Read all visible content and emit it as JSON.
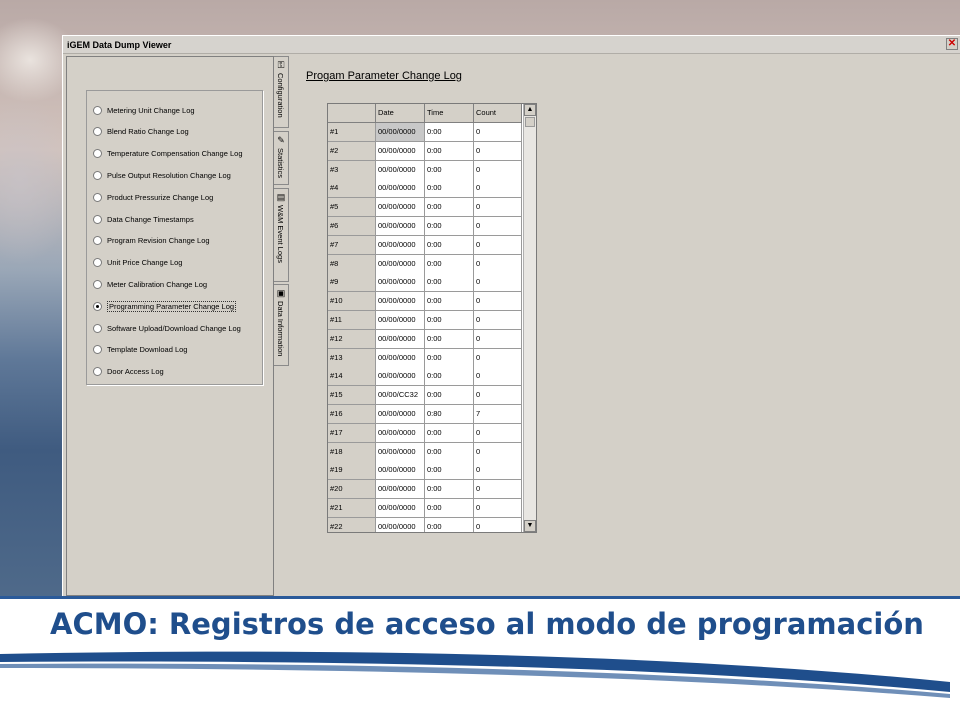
{
  "window": {
    "title": "iGEM Data Dump Viewer",
    "close_glyph": "✕"
  },
  "left_panel": {
    "options": [
      {
        "label": "Metering Unit Change Log",
        "checked": false
      },
      {
        "label": "Blend Ratio Change Log",
        "checked": false
      },
      {
        "label": "Temperature Compensation Change Log",
        "checked": false
      },
      {
        "label": "Pulse Output Resolution Change Log",
        "checked": false
      },
      {
        "label": "Product Pressurize Change Log",
        "checked": false
      },
      {
        "label": "Data Change Timestamps",
        "checked": false
      },
      {
        "label": "Program Revision Change Log",
        "checked": false
      },
      {
        "label": "Unit Price Change Log",
        "checked": false
      },
      {
        "label": "Meter Calibration Change Log",
        "checked": false
      },
      {
        "label": "Programming Parameter Change Log",
        "checked": true
      },
      {
        "label": "Software Upload/Download Change Log",
        "checked": false
      },
      {
        "label": "Template Download Log",
        "checked": false
      },
      {
        "label": "Door Access Log",
        "checked": false
      }
    ]
  },
  "tabs": [
    {
      "label": "Configuration",
      "icon": "key-icon"
    },
    {
      "label": "Statistics",
      "icon": "pencil-icon"
    },
    {
      "label": "W&M Event Logs",
      "icon": "book-icon"
    },
    {
      "label": "Data Information",
      "icon": "igem-icon"
    }
  ],
  "panel": {
    "title": "Progam Parameter Change Log"
  },
  "grid": {
    "columns": [
      "",
      "Date",
      "Time",
      "Count"
    ],
    "rows": [
      {
        "id": "#1",
        "date": "00/00/0000",
        "time": "0:00",
        "count": "0"
      },
      {
        "id": "#2",
        "date": "00/00/0000",
        "time": "0:00",
        "count": "0"
      },
      {
        "id": "#3",
        "date": "00/00/0000",
        "time": "0:00",
        "count": "0"
      },
      {
        "id": "#4",
        "date": "00/00/0000",
        "time": "0:00",
        "count": "0"
      },
      {
        "id": "#5",
        "date": "00/00/0000",
        "time": "0:00",
        "count": "0"
      },
      {
        "id": "#6",
        "date": "00/00/0000",
        "time": "0:00",
        "count": "0"
      },
      {
        "id": "#7",
        "date": "00/00/0000",
        "time": "0:00",
        "count": "0"
      },
      {
        "id": "#8",
        "date": "00/00/0000",
        "time": "0:00",
        "count": "0"
      },
      {
        "id": "#9",
        "date": "00/00/0000",
        "time": "0:00",
        "count": "0"
      },
      {
        "id": "#10",
        "date": "00/00/0000",
        "time": "0:00",
        "count": "0"
      },
      {
        "id": "#11",
        "date": "00/00/0000",
        "time": "0:00",
        "count": "0"
      },
      {
        "id": "#12",
        "date": "00/00/0000",
        "time": "0:00",
        "count": "0"
      },
      {
        "id": "#13",
        "date": "00/00/0000",
        "time": "0:00",
        "count": "0"
      },
      {
        "id": "#14",
        "date": "00/00/0000",
        "time": "0:00",
        "count": "0"
      },
      {
        "id": "#15",
        "date": "00/00/CC32",
        "time": "0:00",
        "count": "0"
      },
      {
        "id": "#16",
        "date": "00/00/0000",
        "time": "0:80",
        "count": "7"
      },
      {
        "id": "#17",
        "date": "00/00/0000",
        "time": "0:00",
        "count": "0"
      },
      {
        "id": "#18",
        "date": "00/00/0000",
        "time": "0:00",
        "count": "0"
      },
      {
        "id": "#19",
        "date": "00/00/0000",
        "time": "0:00",
        "count": "0"
      },
      {
        "id": "#20",
        "date": "00/00/0000",
        "time": "0:00",
        "count": "0"
      },
      {
        "id": "#21",
        "date": "00/00/0000",
        "time": "0:00",
        "count": "0"
      },
      {
        "id": "#22",
        "date": "00/00/0000",
        "time": "0:00",
        "count": "0"
      }
    ],
    "scroll_up_glyph": "▲",
    "scroll_down_glyph": "▼"
  },
  "slide": {
    "title": "ACMO: Registros de acceso al modo de programación",
    "accent_color": "#1f4e8c"
  }
}
